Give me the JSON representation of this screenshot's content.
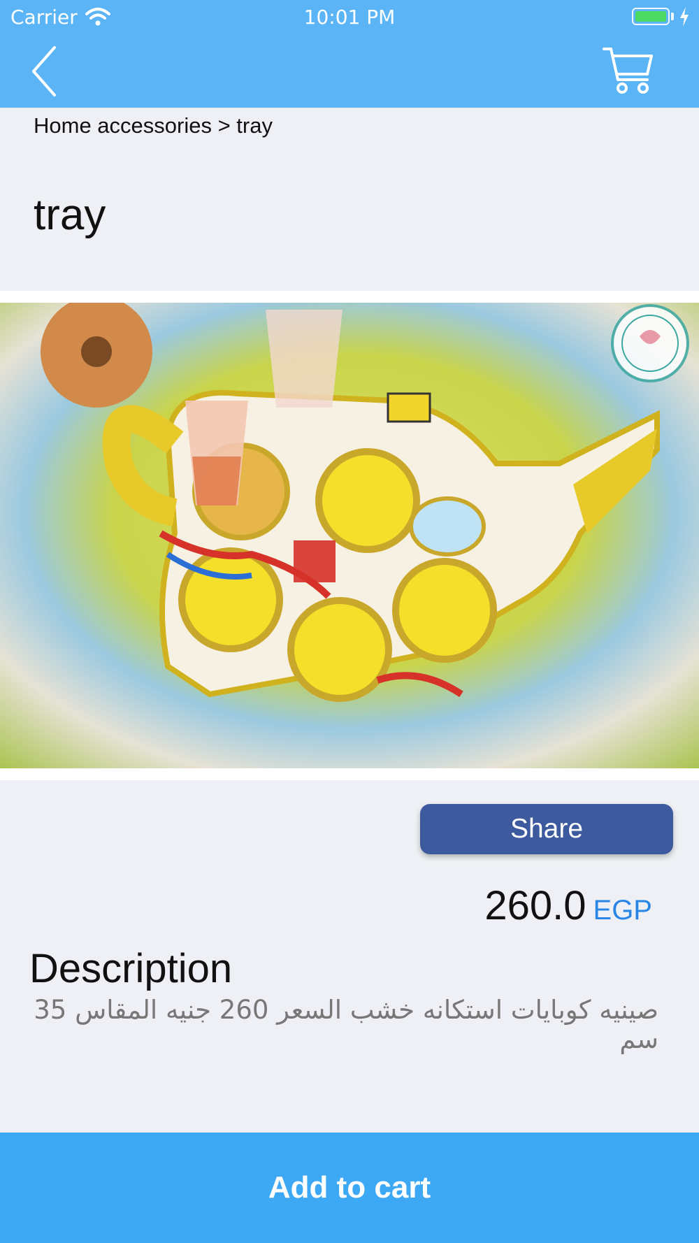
{
  "status_bar": {
    "carrier": "Carrier",
    "time": "10:01 PM"
  },
  "nav": {
    "back_icon": "chevron-left-icon",
    "cart_icon": "shopping-cart-icon"
  },
  "breadcrumb": "Home accessories > tray",
  "product": {
    "title": "tray",
    "image_alt": "tea tray",
    "share_label": "Share",
    "price": "260.0",
    "currency": "EGP",
    "description_heading": "Description",
    "description": "صينيه كوبايات استكانه خشب السعر 260 جنيه المقاس 35 سم"
  },
  "add_to_cart_label": "Add to cart",
  "colors": {
    "header": "#5ab4f5",
    "share": "#3d5a9e",
    "currency": "#2a86e6",
    "cta": "#3da8f4"
  }
}
